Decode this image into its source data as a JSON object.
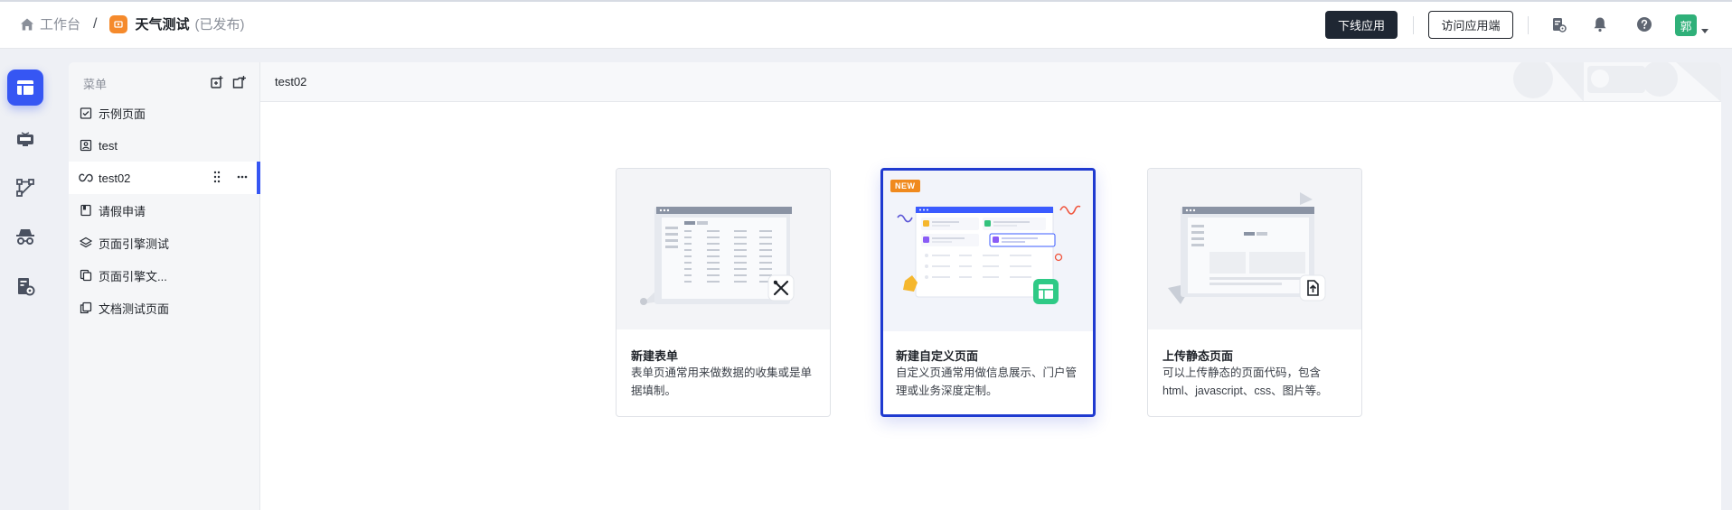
{
  "header": {
    "home_label": "工作台",
    "separator": "/",
    "app_name": "天气测试",
    "app_status": "(已发布)",
    "offline_button": "下线应用",
    "visit_button": "访问应用端",
    "avatar_text": "郭"
  },
  "rail": {
    "items": [
      "pages-icon",
      "monitor-icon",
      "flow-icon",
      "spy-icon",
      "settings-doc-icon"
    ]
  },
  "menu": {
    "title": "菜单",
    "items": [
      {
        "label": "示例页面",
        "icon": "calendar-check-icon"
      },
      {
        "label": "test",
        "icon": "contact-card-icon"
      },
      {
        "label": "test02",
        "icon": "link-icon"
      },
      {
        "label": "请假申请",
        "icon": "notebook-icon"
      },
      {
        "label": "页面引擎测试",
        "icon": "layers-icon"
      },
      {
        "label": "页面引擎文...",
        "icon": "copy-pages-icon"
      },
      {
        "label": "文档测试页面",
        "icon": "duplicate-doc-icon"
      }
    ]
  },
  "content": {
    "title": "test02"
  },
  "cards": [
    {
      "title": "新建表单",
      "desc": "表单页通常用来做数据的收集或是单据填制。"
    },
    {
      "title": "新建自定义页面",
      "desc": "自定义页通常用做信息展示、门户管理或业务深度定制。",
      "badge": "NEW"
    },
    {
      "title": "上传静态页面",
      "desc": "可以上传静态的页面代码，包含html、javascript、css、图片等。"
    }
  ],
  "colors": {
    "accent": "#3656f3",
    "active_card_border": "#1f3ad0",
    "badge": "#f08a1e",
    "avatar": "#2fb079",
    "app_icon": "#f58a2c"
  }
}
